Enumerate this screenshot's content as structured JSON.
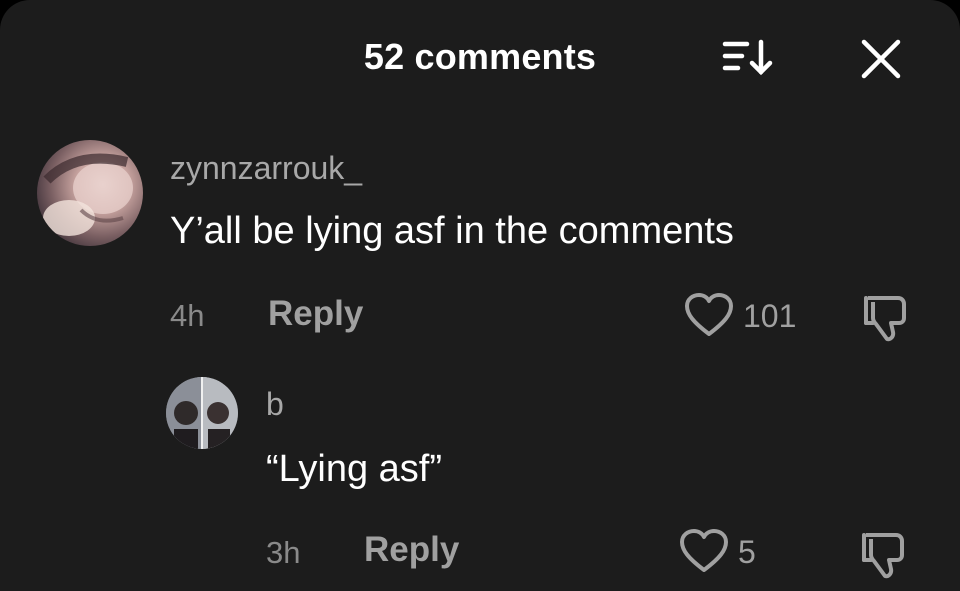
{
  "header": {
    "title": "52 comments",
    "sort_icon": "sort-descending-icon",
    "close_icon": "close-icon"
  },
  "comments": [
    {
      "username": "zynnzarrouk_",
      "text": "Y’all be lying asf in the comments",
      "time": "4h",
      "reply_label": "Reply",
      "likes": "101",
      "like_icon": "heart-outline-icon",
      "dislike_icon": "thumbs-down-icon",
      "replies": [
        {
          "username": "b",
          "text": "“Lying asf”",
          "time": "3h",
          "reply_label": "Reply",
          "likes": "5",
          "like_icon": "heart-outline-icon",
          "dislike_icon": "thumbs-down-icon"
        }
      ]
    }
  ],
  "colors": {
    "background": "#1c1c1c",
    "primary_text": "#ffffff",
    "secondary_text": "#a8a8a8"
  }
}
